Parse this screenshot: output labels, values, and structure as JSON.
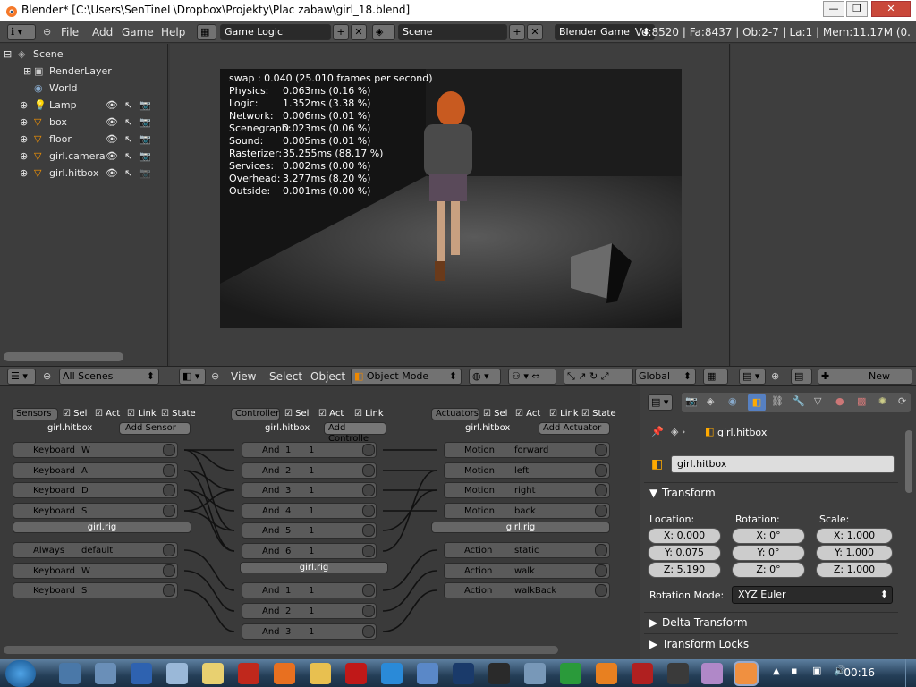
{
  "title_bar": {
    "title": "Blender* [C:\\Users\\SenTineL\\Dropbox\\Projekty\\Plac zabaw\\girl_18.blend]"
  },
  "info_header": {
    "menus": [
      "File",
      "Add",
      "Game",
      "Help"
    ],
    "screen_layout": "Game Logic",
    "scene": "Scene",
    "engine": "Blender Game",
    "stats": "Ve:8520 | Fa:8437 | Ob:2-7 | La:1 | Mem:11.17M (0."
  },
  "outliner": {
    "items": [
      {
        "label": "Scene"
      },
      {
        "label": "RenderLayer"
      },
      {
        "label": "World"
      },
      {
        "label": "Lamp"
      },
      {
        "label": "box"
      },
      {
        "label": "floor"
      },
      {
        "label": "girl.camera"
      },
      {
        "label": "girl.hitbox"
      }
    ],
    "scene_filter": "All Scenes"
  },
  "viewport": {
    "menus": [
      "View",
      "Select",
      "Object"
    ],
    "mode": "Object Mode",
    "orientation": "Global",
    "profile": {
      "swap": "swap : 0.040 (25.010 frames per second)",
      "rows": [
        {
          "k": "Physics:",
          "v": "0.063ms (0.16 %)"
        },
        {
          "k": "Logic:",
          "v": "1.352ms (3.38 %)"
        },
        {
          "k": "Network:",
          "v": "0.006ms (0.01 %)"
        },
        {
          "k": "Scenegraph:",
          "v": "0.023ms (0.06 %)"
        },
        {
          "k": "Sound:",
          "v": "0.005ms (0.01 %)"
        },
        {
          "k": "Rasterizer:",
          "v": "35.255ms (88.17 %)"
        },
        {
          "k": "Services:",
          "v": "0.002ms (0.00 %)"
        },
        {
          "k": "Overhead:",
          "v": "3.277ms (8.20 %)"
        },
        {
          "k": "Outside:",
          "v": "0.001ms (0.00 %)"
        }
      ]
    }
  },
  "right_header": {
    "new_label": "New"
  },
  "logic": {
    "sensors_label": "Sensors",
    "controller_label": "Controller",
    "actuators_label": "Actuators",
    "filters": {
      "sel": "Sel",
      "act": "Act",
      "link": "Link",
      "state": "State"
    },
    "obj_hitbox": "girl.hitbox",
    "obj_rig": "girl.rig",
    "add_sensor": "Add Sensor",
    "add_controller": "Add Controlle",
    "add_actuator": "Add Actuator",
    "sensors_hitbox": [
      {
        "type": "Keyboard",
        "name": "W"
      },
      {
        "type": "Keyboard",
        "name": "A"
      },
      {
        "type": "Keyboard",
        "name": "D"
      },
      {
        "type": "Keyboard",
        "name": "S"
      }
    ],
    "sensors_rig": [
      {
        "type": "Always",
        "name": "default"
      },
      {
        "type": "Keyboard",
        "name": "W"
      },
      {
        "type": "Keyboard",
        "name": "S"
      }
    ],
    "controllers_hitbox": [
      {
        "type": "And",
        "n": "1",
        "s": "1"
      },
      {
        "type": "And",
        "n": "2",
        "s": "1"
      },
      {
        "type": "And",
        "n": "3",
        "s": "1"
      },
      {
        "type": "And",
        "n": "4",
        "s": "1"
      },
      {
        "type": "And",
        "n": "5",
        "s": "1"
      },
      {
        "type": "And",
        "n": "6",
        "s": "1"
      }
    ],
    "controllers_rig": [
      {
        "type": "And",
        "n": "1",
        "s": "1"
      },
      {
        "type": "And",
        "n": "2",
        "s": "1"
      },
      {
        "type": "And",
        "n": "3",
        "s": "1"
      }
    ],
    "actuators_hitbox": [
      {
        "type": "Motion",
        "name": "forward"
      },
      {
        "type": "Motion",
        "name": "left"
      },
      {
        "type": "Motion",
        "name": "right"
      },
      {
        "type": "Motion",
        "name": "back"
      }
    ],
    "actuators_rig": [
      {
        "type": "Action",
        "name": "static"
      },
      {
        "type": "Action",
        "name": "walk"
      },
      {
        "type": "Action",
        "name": "walkBack"
      }
    ]
  },
  "properties": {
    "breadcrumb": "girl.hitbox",
    "object_name": "girl.hitbox",
    "transform_label": "Transform",
    "location_label": "Location:",
    "rotation_label": "Rotation:",
    "scale_label": "Scale:",
    "location": [
      "X: 0.000",
      "Y: 0.075",
      "Z: 5.190"
    ],
    "rotation": [
      "X: 0°",
      "Y: 0°",
      "Z: 0°"
    ],
    "scale": [
      "X: 1.000",
      "Y: 1.000",
      "Z: 1.000"
    ],
    "rotation_mode_label": "Rotation Mode:",
    "rotation_mode": "XYZ Euler",
    "delta_transform": "Delta Transform",
    "transform_locks": "Transform Locks"
  },
  "taskbar": {
    "clock": "00:16"
  }
}
